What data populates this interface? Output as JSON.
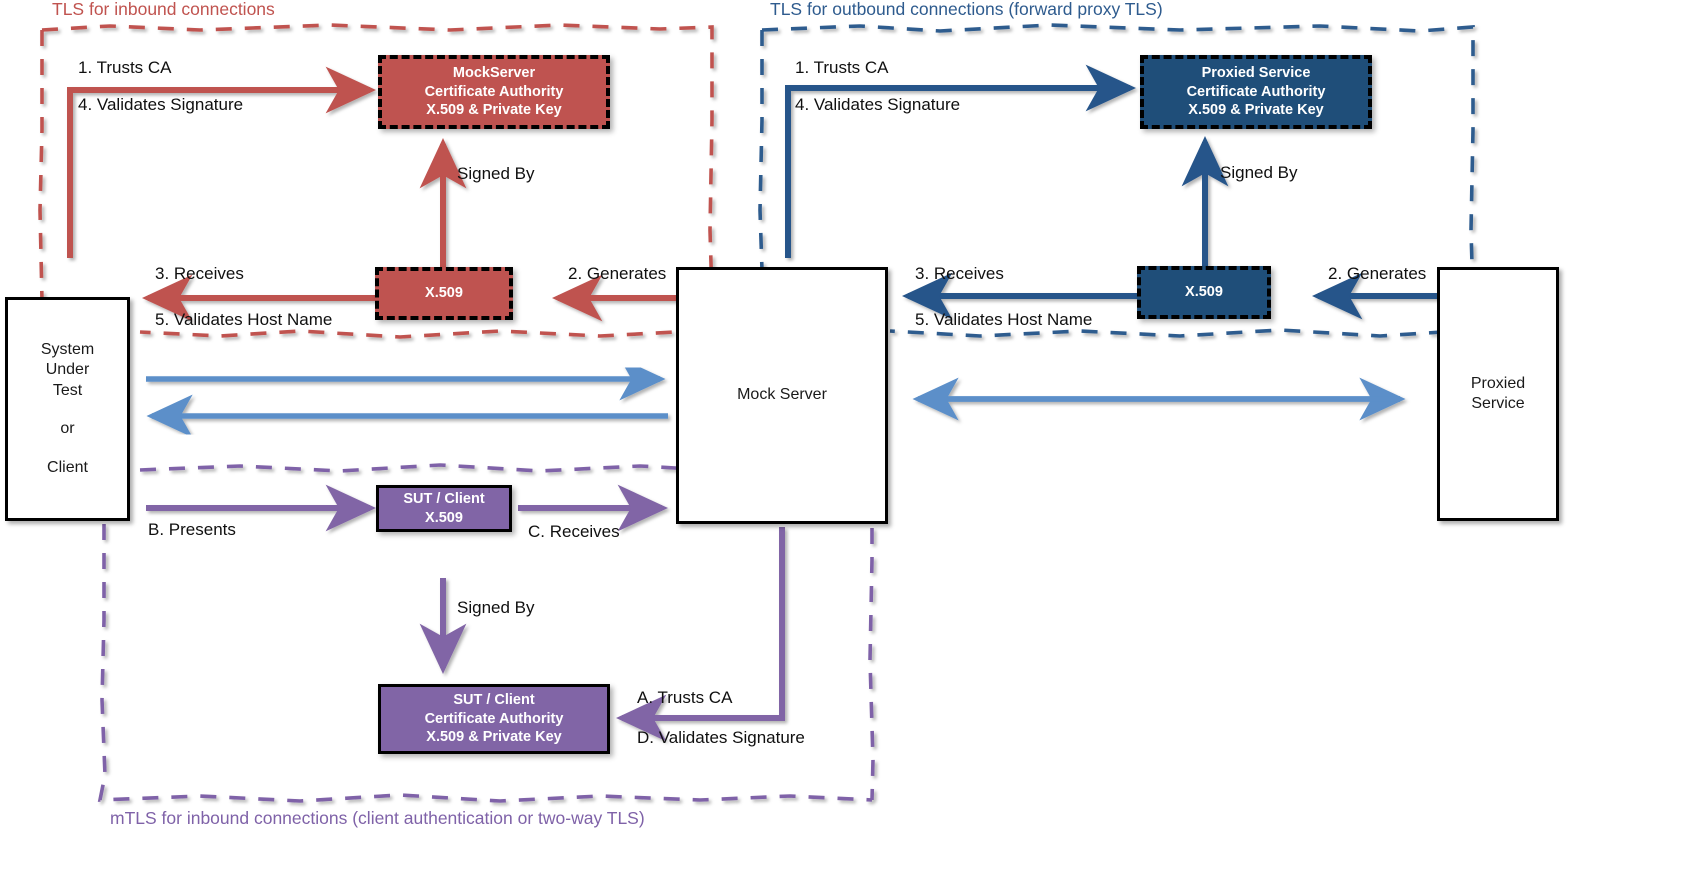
{
  "diagram": {
    "title": "MockServer TLS / mTLS certificate trust diagram",
    "colors": {
      "red": "#bf5350",
      "blue": "#1f4e79",
      "purple": "#8165a6",
      "red_zone": "#c0534f",
      "blue_zone": "#2e5b8e",
      "purple_zone": "#7f62a8",
      "light_blue_arrow": "#5b8fc9"
    }
  },
  "zones": [
    {
      "id": "inbound-tls",
      "label": "TLS for inbound connections"
    },
    {
      "id": "outbound-tls",
      "label": "TLS for outbound connections (forward proxy TLS)"
    },
    {
      "id": "inbound-mtls",
      "label": "mTLS for inbound connections (client authentication or two-way TLS)"
    }
  ],
  "nodes": {
    "sut": {
      "lines": [
        "System",
        "Under",
        "Test",
        "",
        "or",
        "",
        "Client"
      ]
    },
    "mock_server": {
      "label": "Mock Server"
    },
    "proxied_service": {
      "lines": [
        "Proxied",
        "Service"
      ]
    },
    "mockserver_ca": {
      "lines": [
        "MockServer",
        "Certificate Authority",
        "X.509 & Private Key"
      ]
    },
    "proxied_ca": {
      "lines": [
        "Proxied Service",
        "Certificate Authority",
        "X.509 & Private Key"
      ]
    },
    "sut_client_ca": {
      "lines": [
        "SUT / Client",
        "Certificate Authority",
        "X.509 & Private Key"
      ]
    },
    "mockserver_x509": {
      "label": "X.509"
    },
    "proxied_x509": {
      "label": "X.509"
    },
    "sut_client_x509": {
      "lines": [
        "SUT / Client",
        "X.509"
      ]
    }
  },
  "edge_labels": {
    "red_trusts_ca": "1. Trusts CA",
    "red_validates_signature": "4. Validates Signature",
    "red_signed_by": "Signed By",
    "red_receives": "3. Receives",
    "red_validates_host_name": "5. Validates Host Name",
    "red_generates": "2. Generates",
    "blue_trusts_ca": "1. Trusts CA",
    "blue_validates_signature": "4. Validates Signature",
    "blue_signed_by": "Signed By",
    "blue_receives": "3. Receives",
    "blue_validates_host_name": "5. Validates Host Name",
    "blue_generates": "2. Generates",
    "purple_presents": "B. Presents",
    "purple_receives": "C. Receives",
    "purple_signed_by": "Signed By",
    "purple_trusts_ca": "A. Trusts CA",
    "purple_validates_signature": "D. Validates Signature"
  }
}
